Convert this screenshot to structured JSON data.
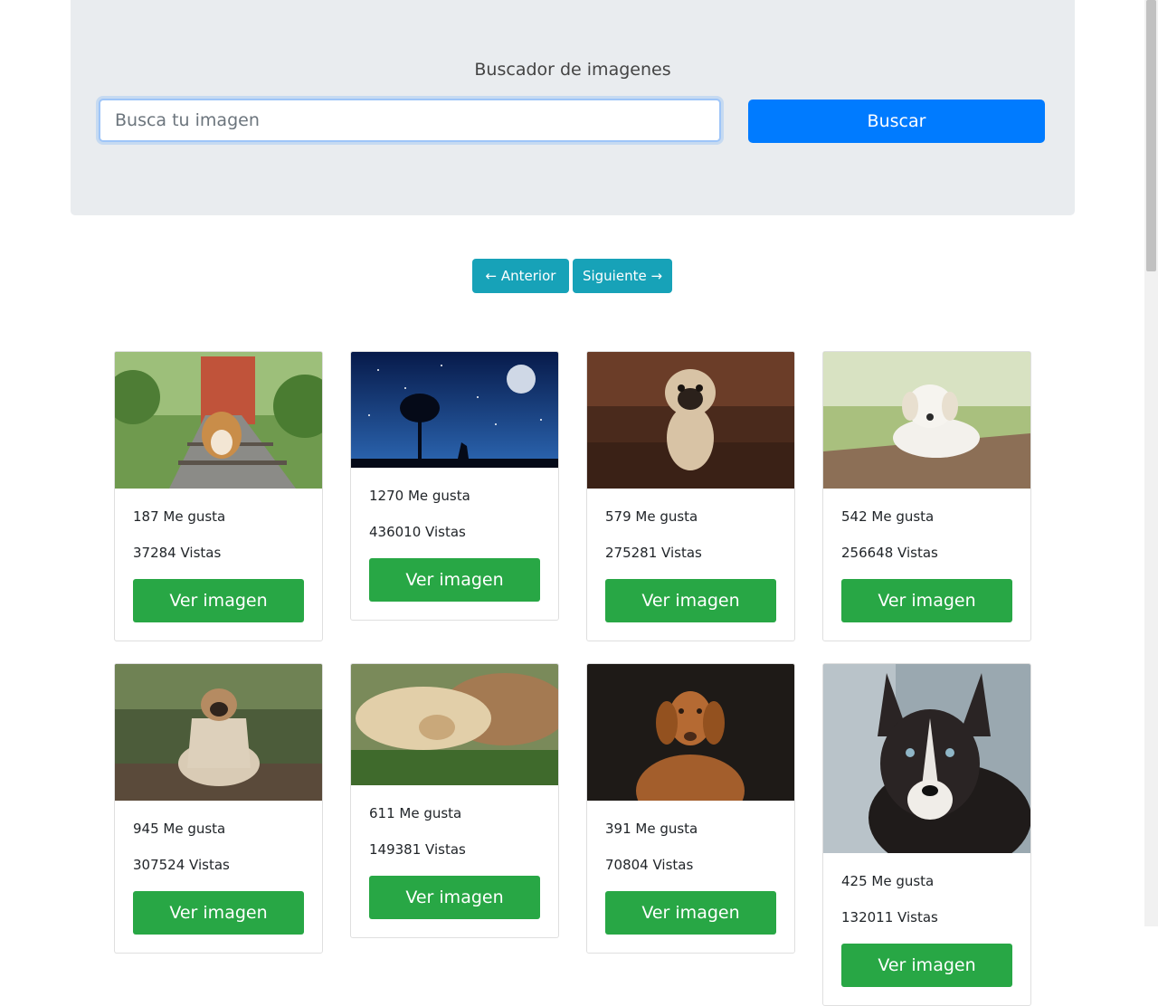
{
  "header": {
    "title": "Buscador de imagenes",
    "search_placeholder": "Busca tu imagen",
    "search_button": "Buscar"
  },
  "pagination": {
    "prev_label": "← Anterior",
    "next_label": "Siguiente →"
  },
  "cards": [
    {
      "likes": "187 Me gusta",
      "views": "37284 Vistas",
      "button": "Ver imagen",
      "image": "corgi on train tracks"
    },
    {
      "likes": "1270 Me gusta",
      "views": "436010 Vistas",
      "button": "Ver imagen",
      "image": "starry night with moon and tree"
    },
    {
      "likes": "579 Me gusta",
      "views": "275281 Vistas",
      "button": "Ver imagen",
      "image": "pug puppy on wooden floor"
    },
    {
      "likes": "542 Me gusta",
      "views": "256648 Vistas",
      "button": "Ver imagen",
      "image": "white puppy lying on deck"
    },
    {
      "likes": "945 Me gusta",
      "views": "307524 Vistas",
      "button": "Ver imagen",
      "image": "pug wrapped in blanket"
    },
    {
      "likes": "611 Me gusta",
      "views": "149381 Vistas",
      "button": "Ver imagen",
      "image": "dog and cat cuddling"
    },
    {
      "likes": "391 Me gusta",
      "views": "70804 Vistas",
      "button": "Ver imagen",
      "image": "brown vizsla dog portrait"
    },
    {
      "likes": "425 Me gusta",
      "views": "132011 Vistas",
      "button": "Ver imagen",
      "image": "husky portrait"
    }
  ],
  "colors": {
    "primary": "#007bff",
    "info": "#17a2b8",
    "success": "#28a745",
    "jumbotron": "#e9ecef"
  }
}
